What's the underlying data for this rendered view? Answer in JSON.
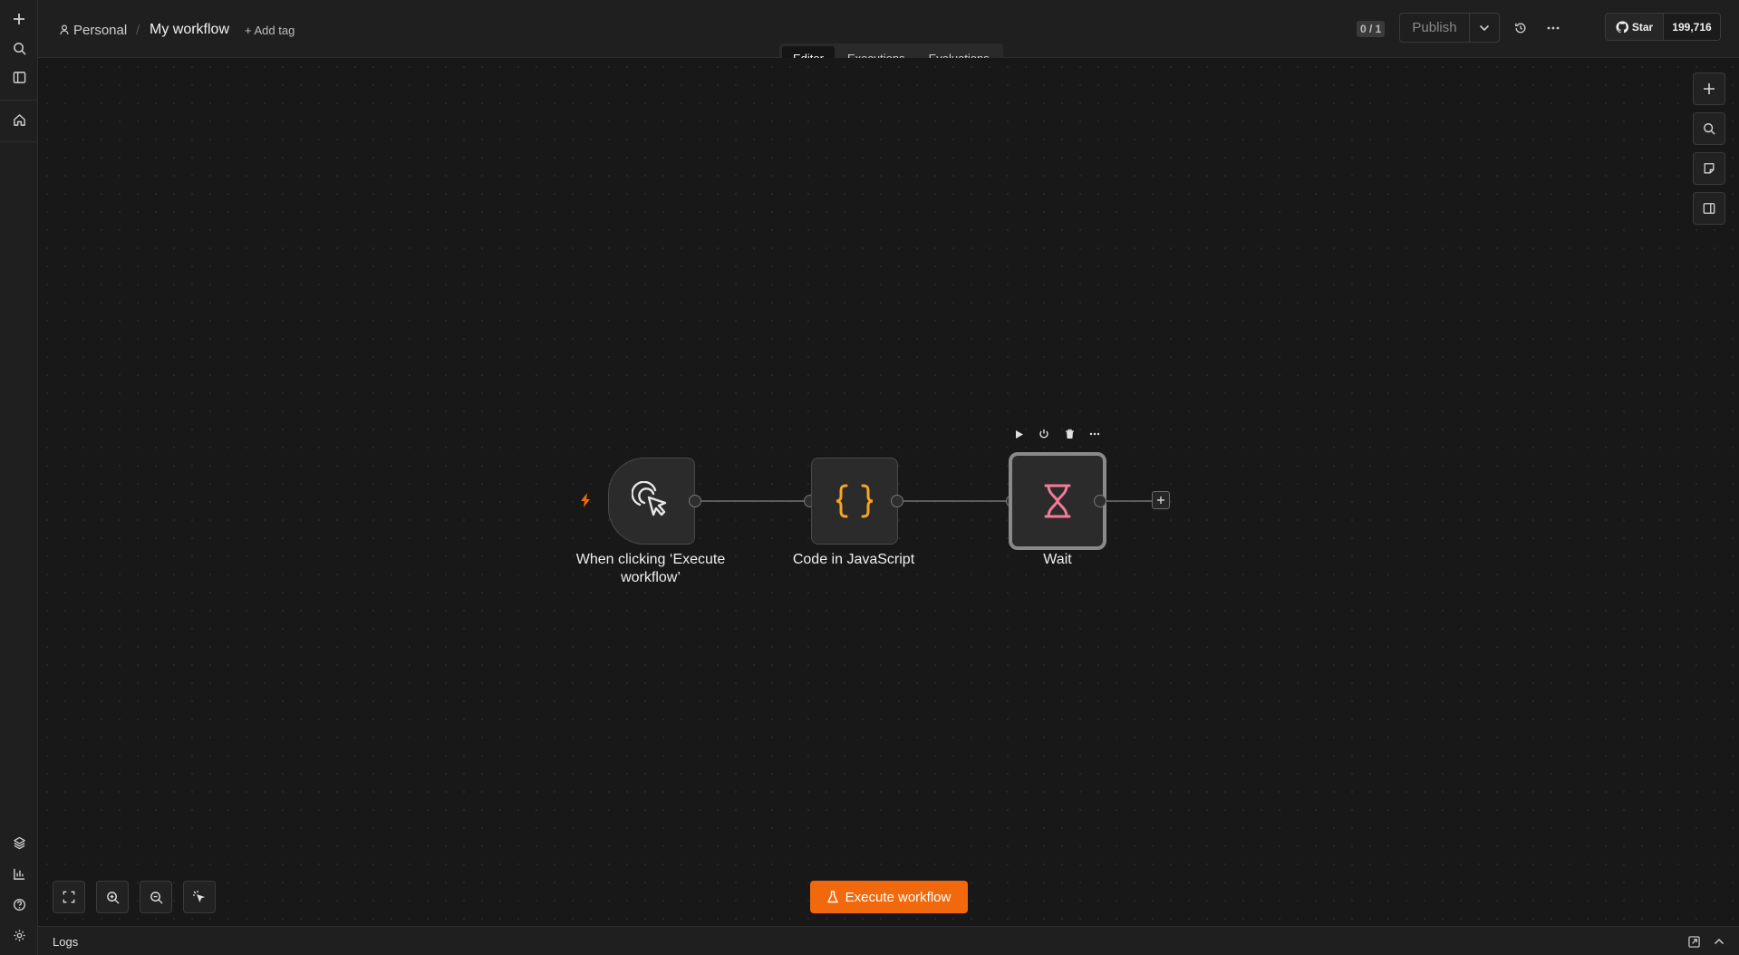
{
  "header": {
    "project": "Personal",
    "separator": "/",
    "workflow_name": "My workflow",
    "add_tag": "+ Add tag",
    "version_counter": "0 / 1",
    "publish": "Publish",
    "github_star": "Star",
    "github_count": "199,716"
  },
  "tabs": [
    {
      "label": "Editor",
      "active": true
    },
    {
      "label": "Executions",
      "active": false
    },
    {
      "label": "Evaluations",
      "active": false
    }
  ],
  "nodes": [
    {
      "name": "When clicking ‘Execute workflow’",
      "icon": "cursor-click-icon"
    },
    {
      "name": "Code in JavaScript",
      "icon": "braces-icon"
    },
    {
      "name": "Wait",
      "icon": "hourglass-icon"
    }
  ],
  "execute_button": "Execute workflow",
  "logs": {
    "label": "Logs"
  },
  "colors": {
    "accent": "#f2690d",
    "code_icon": "#f5a623",
    "wait_icon": "#f47b97",
    "trigger_bolt": "#f2690d"
  }
}
